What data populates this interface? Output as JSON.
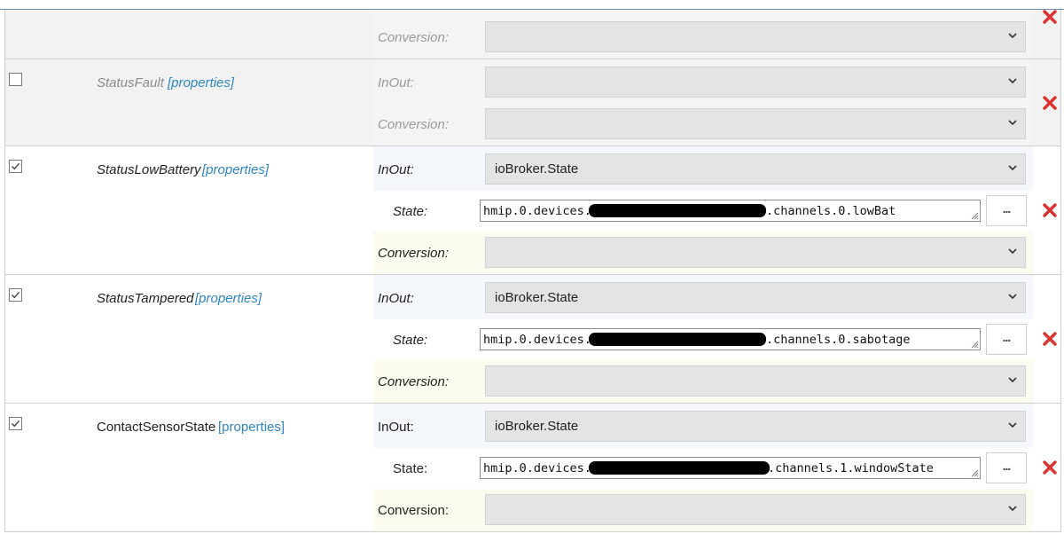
{
  "colors": {
    "accent_link": "#2e86c1",
    "delete_red": "#d9322f",
    "select_bg": "#e4e4e4"
  },
  "top_partial": {
    "conversion_label": "Conversion:",
    "conversion_value": ""
  },
  "rows": [
    {
      "name": "StatusFault",
      "properties_label": "[properties]",
      "checked": false,
      "inout_label": "InOut:",
      "inout_value": "",
      "conversion_label": "Conversion:",
      "conversion_value": ""
    },
    {
      "name": "StatusLowBattery",
      "properties_label": "[properties]",
      "checked": true,
      "inout_label": "InOut:",
      "inout_value": "ioBroker.State",
      "state_label": "State:",
      "state_prefix": "hmip.0.devices.",
      "state_suffix": ".channels.0.lowBat",
      "browse_label": "...",
      "conversion_label": "Conversion:",
      "conversion_value": ""
    },
    {
      "name": "StatusTampered",
      "properties_label": "[properties]",
      "checked": true,
      "inout_label": "InOut:",
      "inout_value": "ioBroker.State",
      "state_label": "State:",
      "state_prefix": "hmip.0.devices.",
      "state_suffix": ".channels.0.sabotage",
      "browse_label": "...",
      "conversion_label": "Conversion:",
      "conversion_value": ""
    },
    {
      "name": "ContactSensorState",
      "properties_label": "[properties]",
      "checked": true,
      "inout_label": "InOut:",
      "inout_value": "ioBroker.State",
      "state_label": "State:",
      "state_prefix": "hmip.0.devices.",
      "state_suffix": ".channels.1.windowState",
      "browse_label": "...",
      "conversion_label": "Conversion:",
      "conversion_value": ""
    }
  ]
}
